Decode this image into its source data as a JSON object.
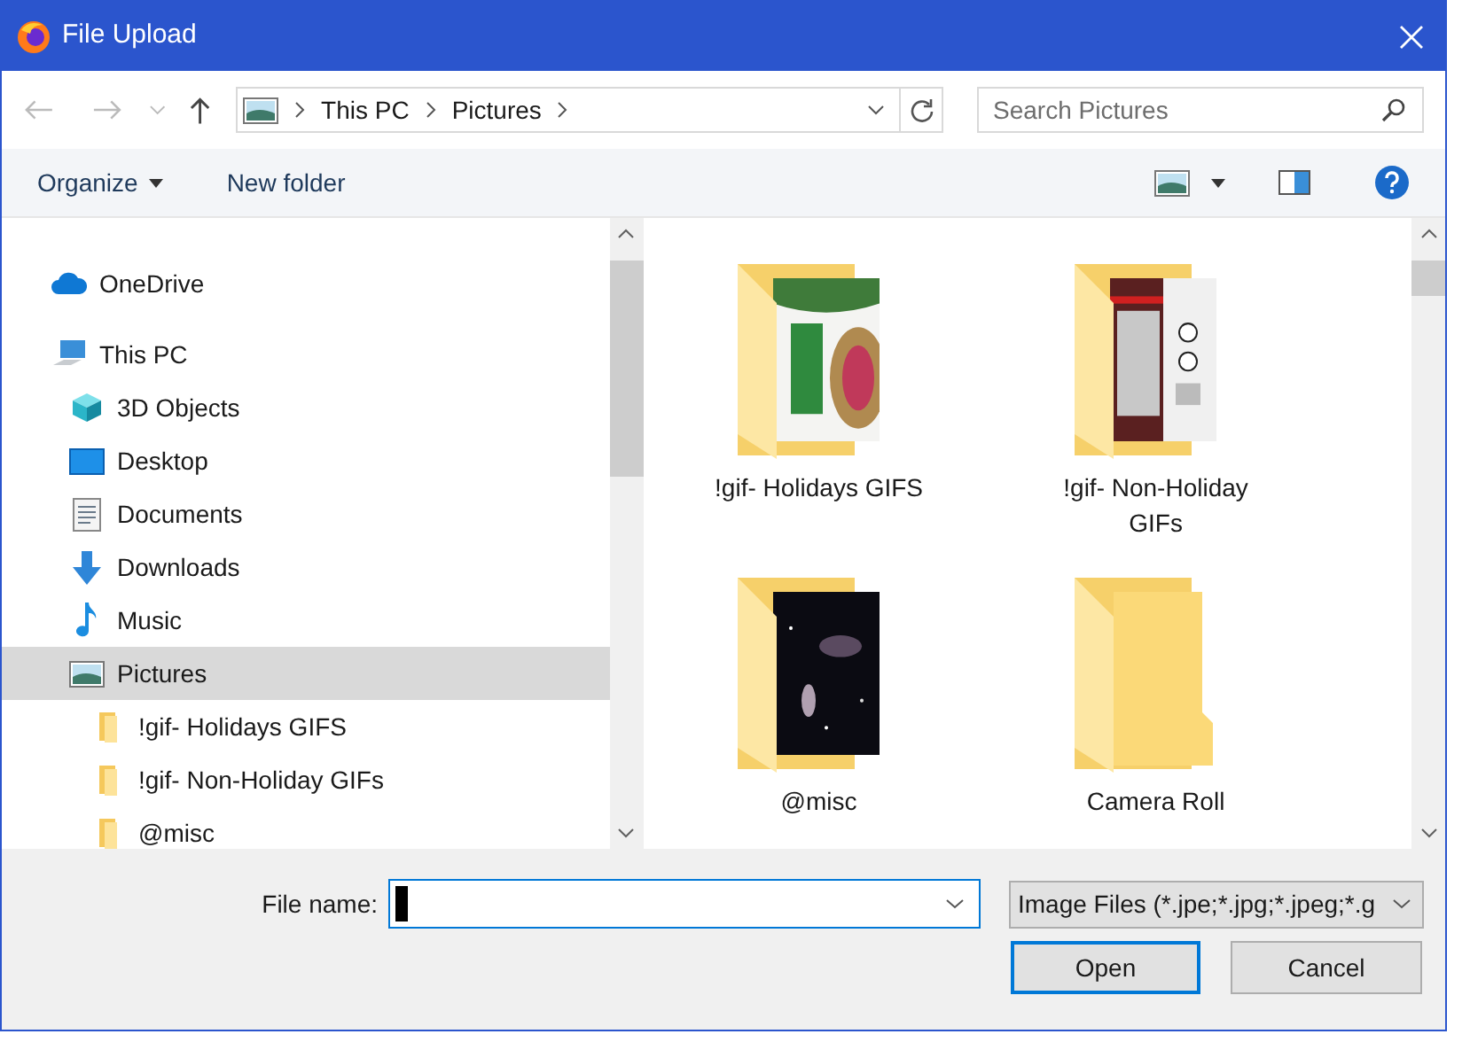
{
  "window": {
    "title": "File Upload"
  },
  "address": {
    "crumbs": [
      "This PC",
      "Pictures"
    ]
  },
  "search": {
    "placeholder": "Search Pictures"
  },
  "toolbar": {
    "organize": "Organize",
    "new_folder": "New folder"
  },
  "nav": [
    {
      "label": "OneDrive",
      "kind": "cloud",
      "selected": false
    },
    {
      "label": "This PC",
      "kind": "pc",
      "selected": false,
      "children": [
        {
          "label": "3D Objects",
          "kind": "cube",
          "selected": false
        },
        {
          "label": "Desktop",
          "kind": "desktop",
          "selected": false
        },
        {
          "label": "Documents",
          "kind": "document",
          "selected": false
        },
        {
          "label": "Downloads",
          "kind": "download",
          "selected": false
        },
        {
          "label": "Music",
          "kind": "music",
          "selected": false
        },
        {
          "label": "Pictures",
          "kind": "pictures",
          "selected": true,
          "children": [
            {
              "label": "!gif- Holidays GIFS",
              "kind": "folder",
              "selected": false
            },
            {
              "label": "!gif- Non-Holiday GIFs",
              "kind": "folder",
              "selected": false
            },
            {
              "label": "@misc",
              "kind": "folder",
              "selected": false
            }
          ]
        }
      ]
    }
  ],
  "items": [
    {
      "label": "!gif- Holidays GIFS",
      "preview": true
    },
    {
      "label": "!gif- Non-Holiday GIFs",
      "preview": true
    },
    {
      "label": "@misc",
      "preview": true
    },
    {
      "label": "Camera Roll",
      "preview": false
    }
  ],
  "file_name": {
    "label": "File name:"
  },
  "file_type": {
    "value": "Image Files (*.jpe;*.jpg;*.jpeg;*.g"
  },
  "buttons": {
    "open": "Open",
    "cancel": "Cancel"
  }
}
